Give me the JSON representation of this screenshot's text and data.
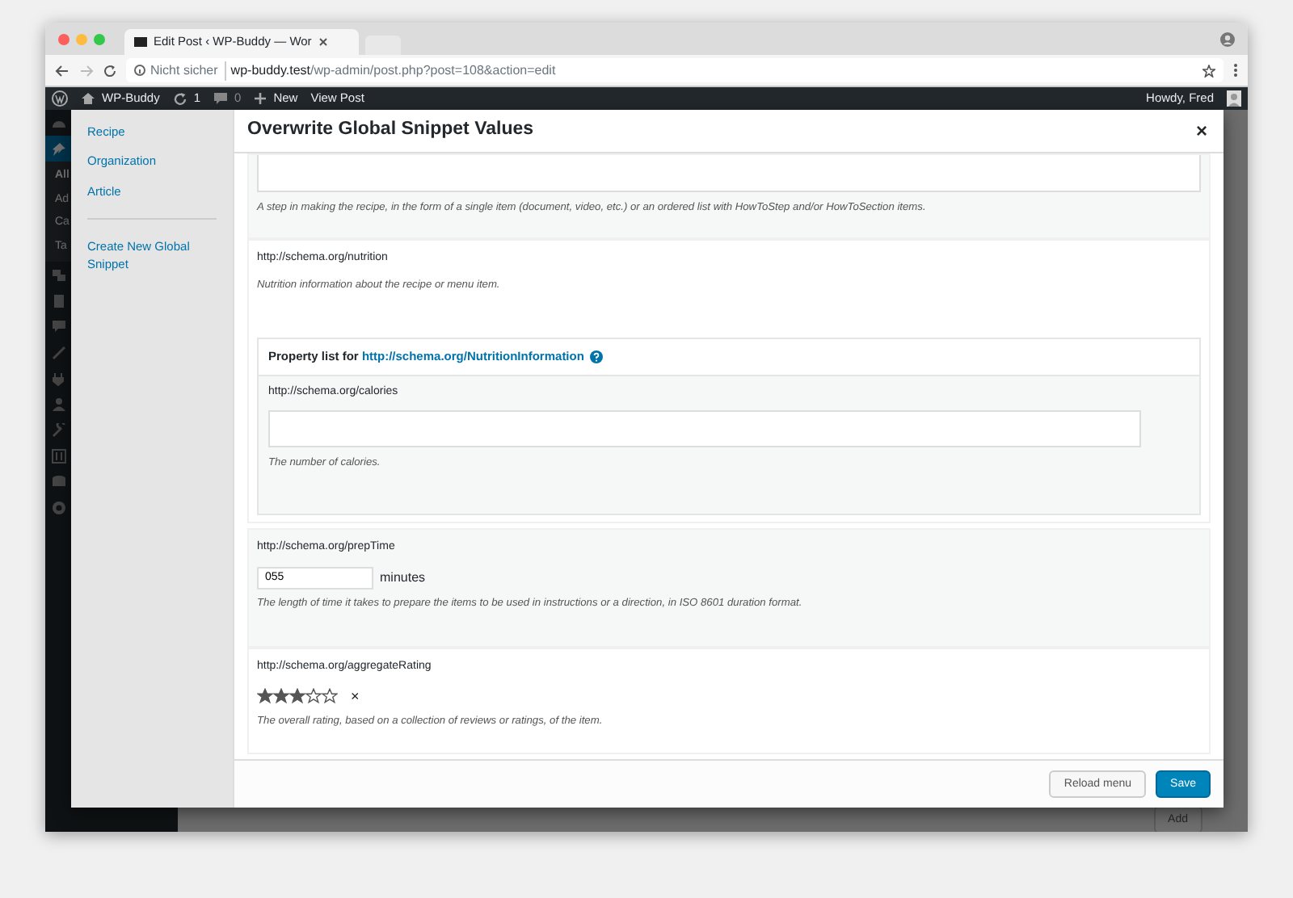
{
  "browser": {
    "tab_title": "Edit Post ‹ WP-Buddy — Wor",
    "security": "Nicht sicher",
    "url_host": "wp-buddy.test",
    "url_path": "/wp-admin/post.php?post=108&action=edit"
  },
  "admin_bar": {
    "site": "WP-Buddy",
    "updates": "1",
    "comments": "0",
    "new": "New",
    "view": "View Post",
    "greeting": "Howdy, Fred"
  },
  "admin_menu": {
    "submenu": [
      {
        "label": "All",
        "selected": true
      },
      {
        "label": "Ad",
        "selected": false
      },
      {
        "label": "Ca",
        "selected": false
      },
      {
        "label": "Ta",
        "selected": false
      }
    ]
  },
  "modal": {
    "title": "Overwrite Global Snippet Values",
    "close": "×",
    "nav": [
      "Recipe",
      "Organization",
      "Article"
    ],
    "create_link": "Create New Global Snippet",
    "fields": [
      {
        "kind": "textarea-tail",
        "description": "A step in making the recipe, in the form of a single item (document, video, etc.) or an ordered list with HowToStep and/or HowToSection items."
      },
      {
        "kind": "nested",
        "label": "http://schema.org/nutrition",
        "description": "Nutrition information about the recipe or menu item.",
        "property_list": {
          "prefix": "Property list for",
          "link": "http://schema.org/NutritionInformation",
          "fields": [
            {
              "label": "http://schema.org/calories",
              "description": "The number of calories."
            }
          ]
        }
      },
      {
        "kind": "duration",
        "label": "http://schema.org/prepTime",
        "value": "055",
        "unit": "minutes",
        "description": "The length of time it takes to prepare the items to be used in instructions or a direction, in ISO 8601 duration format."
      },
      {
        "kind": "rating",
        "label": "http://schema.org/aggregateRating",
        "stars": 3,
        "clear": "×",
        "description": "The overall rating, based on a collection of reviews or ratings, of the item."
      }
    ],
    "buttons": [
      {
        "kind": "secondary",
        "label": "Reload menu"
      },
      {
        "kind": "primary",
        "label": "Save"
      }
    ]
  },
  "behind": {
    "button": "Add"
  }
}
